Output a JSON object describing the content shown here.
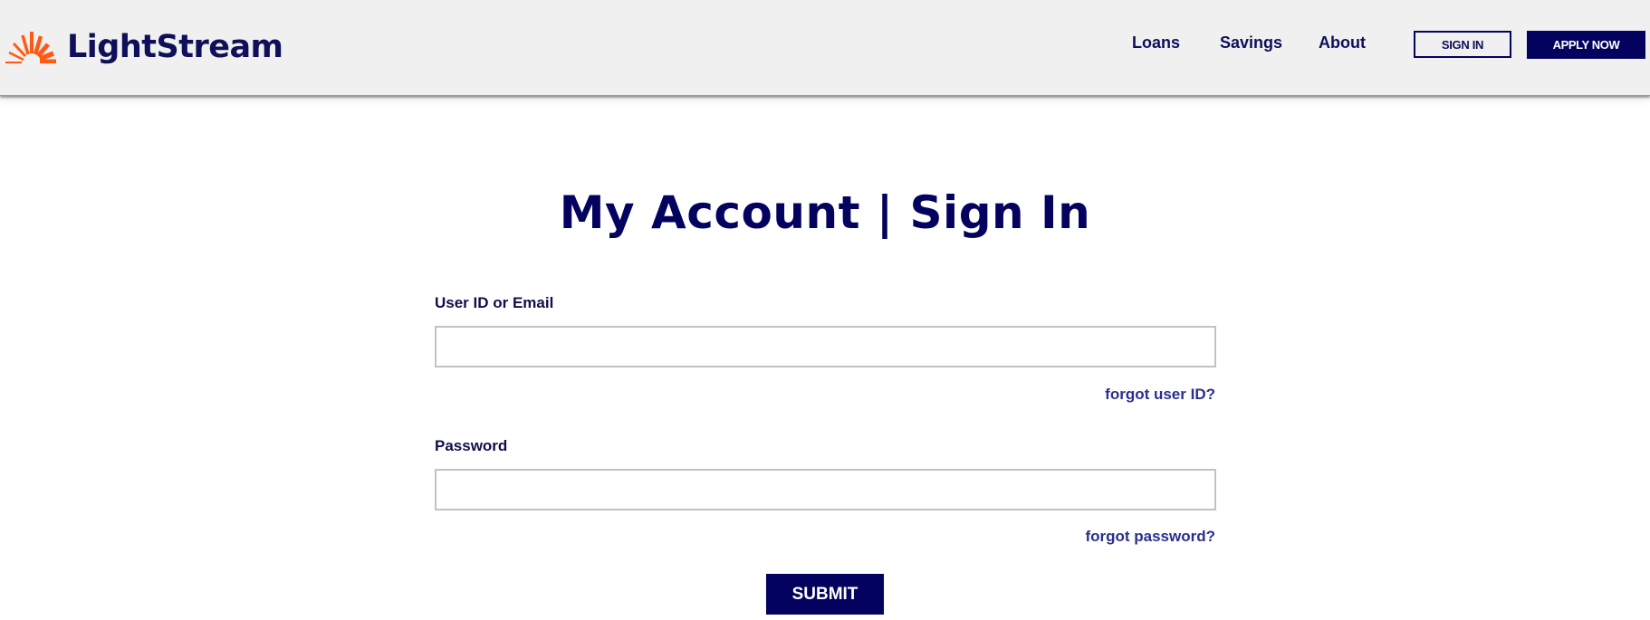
{
  "brand": {
    "name": "LightStream",
    "logo_icon": "sunburst-icon",
    "colors": {
      "primary": "#03035f",
      "accent": "#ff5a14",
      "link": "#2a2f8f",
      "header_bg": "#f0f0f0"
    }
  },
  "nav": {
    "links": [
      {
        "label": "Loans"
      },
      {
        "label": "Savings"
      },
      {
        "label": "About"
      }
    ],
    "sign_in_label": "SIGN IN",
    "apply_now_label": "APPLY NOW"
  },
  "page": {
    "title": "My Account | Sign In"
  },
  "form": {
    "user_id": {
      "label": "User ID or Email",
      "value": "",
      "placeholder": ""
    },
    "forgot_user_id": "forgot user ID?",
    "password": {
      "label": "Password",
      "value": "",
      "placeholder": ""
    },
    "forgot_password": "forgot password?",
    "submit_label": "SUBMIT"
  }
}
